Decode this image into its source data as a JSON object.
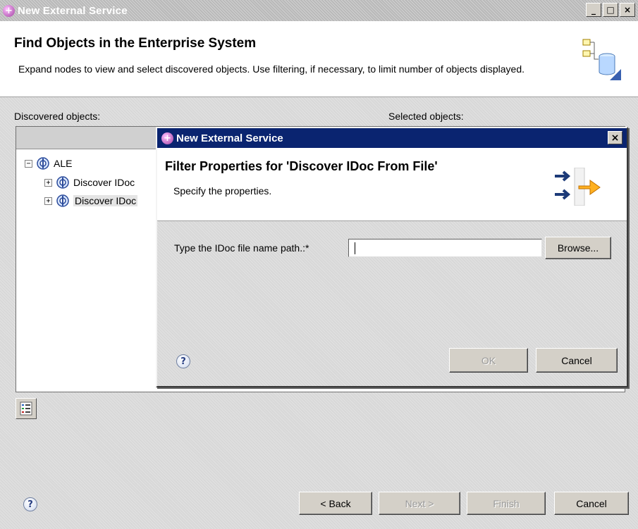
{
  "outer_window": {
    "title": "New External Service",
    "controls": {
      "minimize": "_",
      "maximize": "□",
      "close": "×"
    },
    "header_title": "Find Objects in the Enterprise System",
    "header_description": "Expand nodes to view and select discovered objects.  Use filtering, if necessary, to limit number of objects displayed.",
    "discovered_label": "Discovered objects:",
    "selected_label": "Selected objects:",
    "tree": [
      {
        "label": "ALE",
        "expander": "−",
        "level": 0
      },
      {
        "label": "Discover IDoc",
        "expander": "+",
        "level": 1
      },
      {
        "label": "Discover IDoc",
        "expander": "+",
        "level": 1,
        "selected": true
      }
    ],
    "buttons": {
      "back": "< Back",
      "next": "Next >",
      "finish": "Finish",
      "cancel": "Cancel"
    },
    "help_glyph": "?"
  },
  "inner_dialog": {
    "title": "New External Service",
    "close_glyph": "×",
    "header_title": "Filter Properties for 'Discover IDoc From File'",
    "header_description": "Specify the properties.",
    "field_label": "Type the IDoc file name path.:*",
    "field_value": "",
    "browse_label": "Browse...",
    "ok_label": "OK",
    "cancel_label": "Cancel",
    "help_glyph": "?"
  },
  "icons": [
    "app-icon",
    "help-icon",
    "filter-icon",
    "sap-node-icon",
    "database-icon",
    "import-arrows-icon"
  ]
}
